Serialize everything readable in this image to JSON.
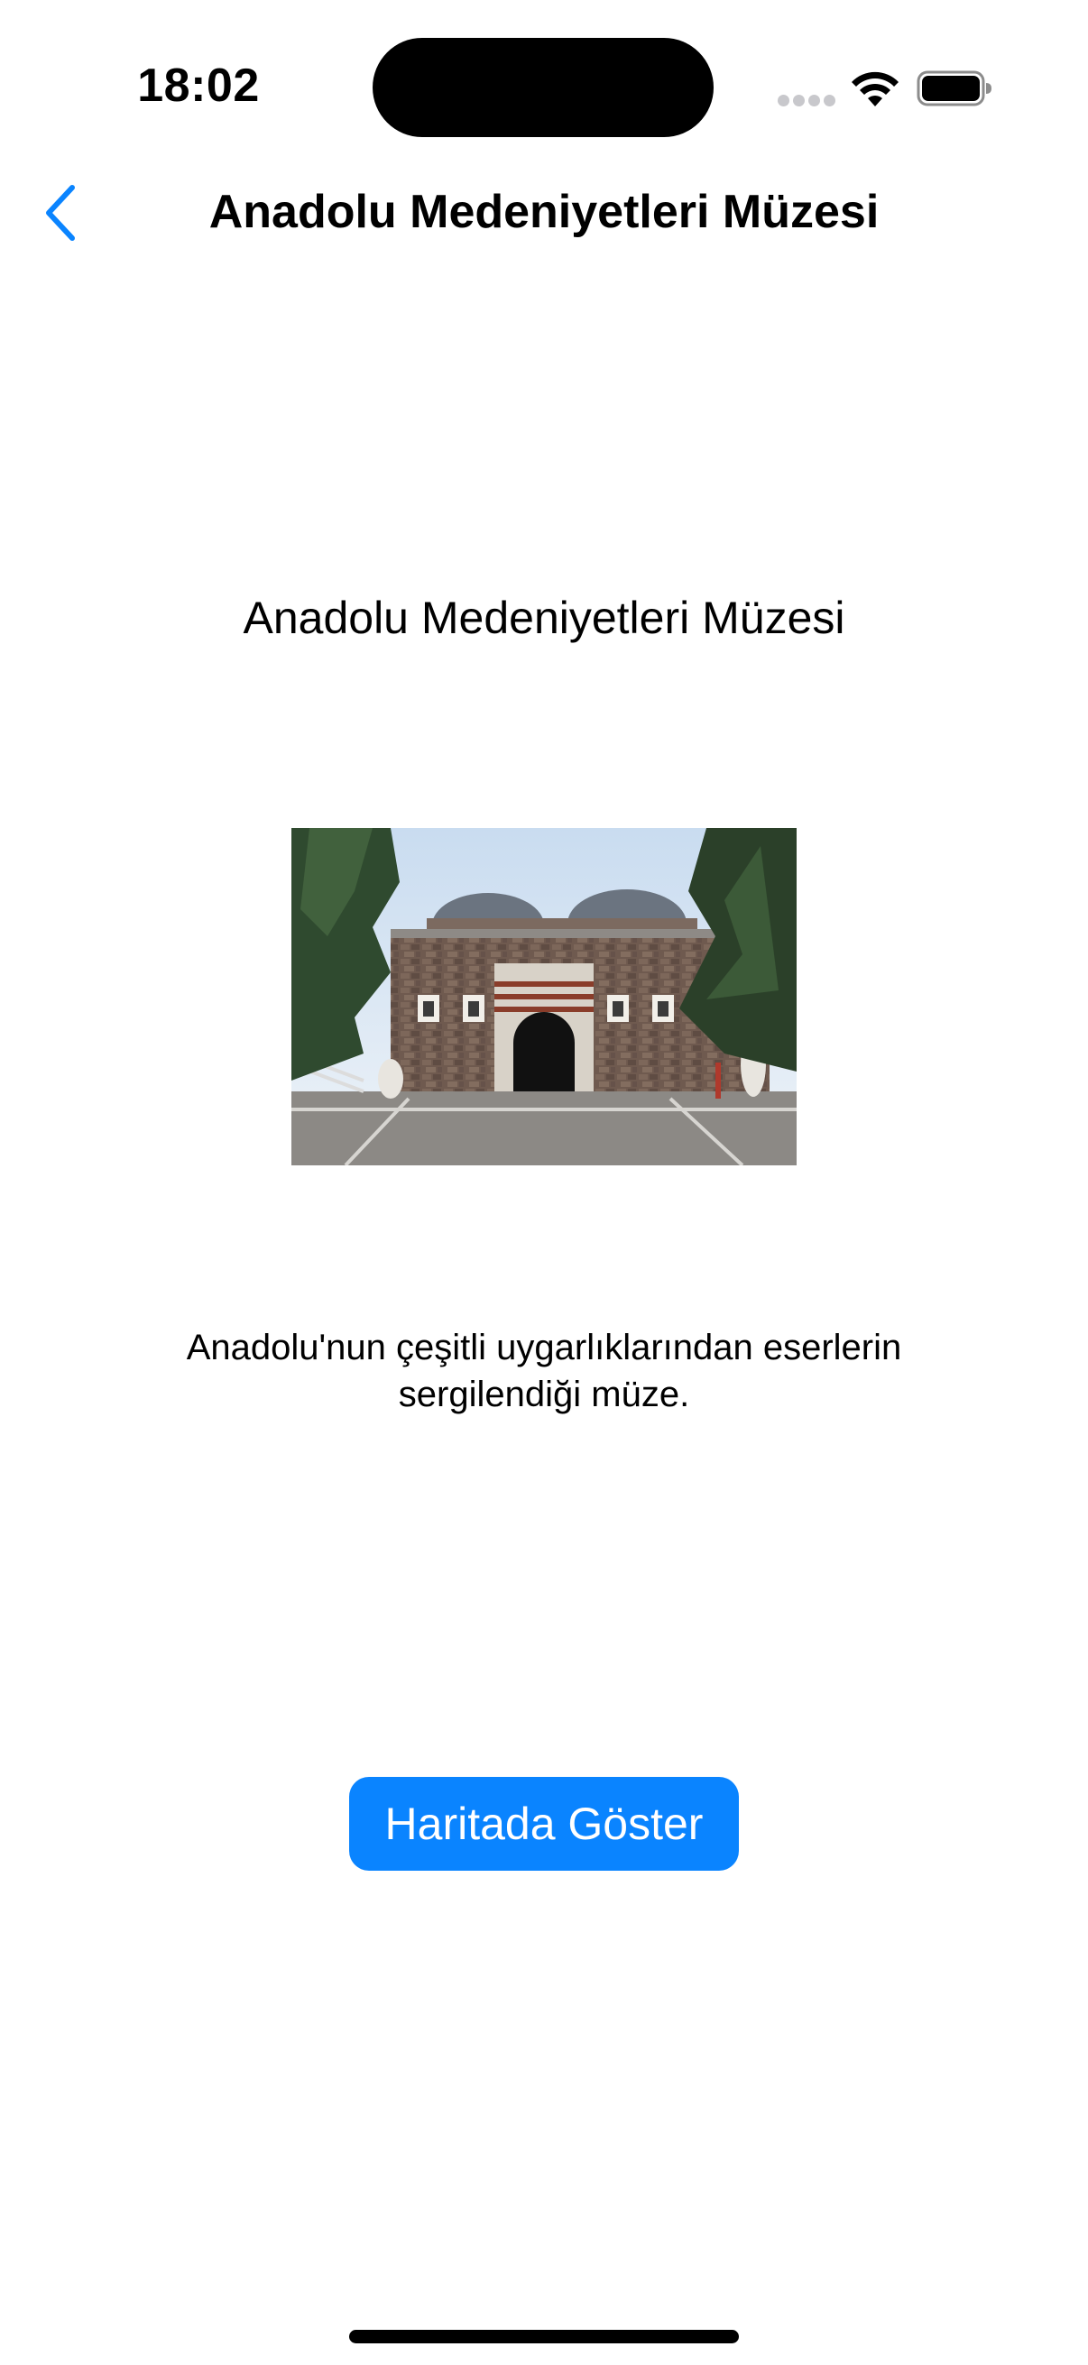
{
  "status_bar": {
    "time": "18:02",
    "icons": [
      "cellular-signal-icon",
      "wifi-icon",
      "battery-icon"
    ]
  },
  "nav": {
    "back_icon": "chevron-left-icon",
    "title": "Anadolu Medeniyetleri Müzesi"
  },
  "place": {
    "name": "Anadolu Medeniyetleri Müzesi",
    "description": "Anadolu'nun çeşitli uygarlıklarından eserlerin sergilendiği müze.",
    "button_label": "Haritada Göster"
  },
  "colors": {
    "accent": "#0a84ff",
    "text": "#000000",
    "background": "#ffffff"
  }
}
